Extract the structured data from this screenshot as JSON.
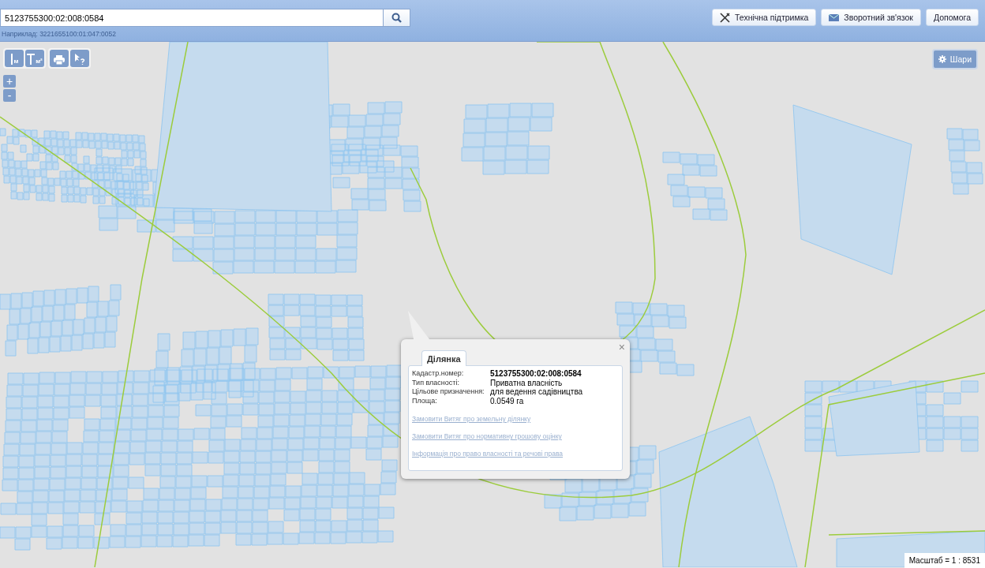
{
  "search": {
    "value": "5123755300:02:008:0584",
    "hint": "Наприклад: 3221655100:01:047:0052"
  },
  "header_buttons": [
    {
      "kind": "support",
      "label": "Технічна підтримка"
    },
    {
      "kind": "feedback",
      "label": "Зворотний зв'язок"
    },
    {
      "kind": "plain",
      "label": "Допомога"
    }
  ],
  "map_tools": [
    {
      "kind": "distance",
      "unit": "м"
    },
    {
      "kind": "area",
      "unit": "м²"
    },
    {
      "kind": "print"
    },
    {
      "kind": "info"
    }
  ],
  "zoom": {
    "in": "+",
    "out": "-"
  },
  "layers_button": {
    "label": "Шари"
  },
  "popup": {
    "close": "×",
    "tab": "Ділянка",
    "rows": [
      {
        "label": "Кадастр.номер:",
        "value": "5123755300:02:008:0584",
        "bold": true
      },
      {
        "label": "Тип власності:",
        "value": "Приватна власність",
        "bold": false
      },
      {
        "label": "Цільове призначення:",
        "value": "для ведення садівництва",
        "bold": false
      },
      {
        "label": "Площа:",
        "value": "0.0549 га",
        "bold": false
      }
    ],
    "links": [
      "Замовити Витяг про земельну ділянку",
      "Замовити Витяг про нормативну грошову оцінку",
      "Інформація про право власності та речові права"
    ]
  },
  "scale": "Масштаб = 1 : 8531"
}
